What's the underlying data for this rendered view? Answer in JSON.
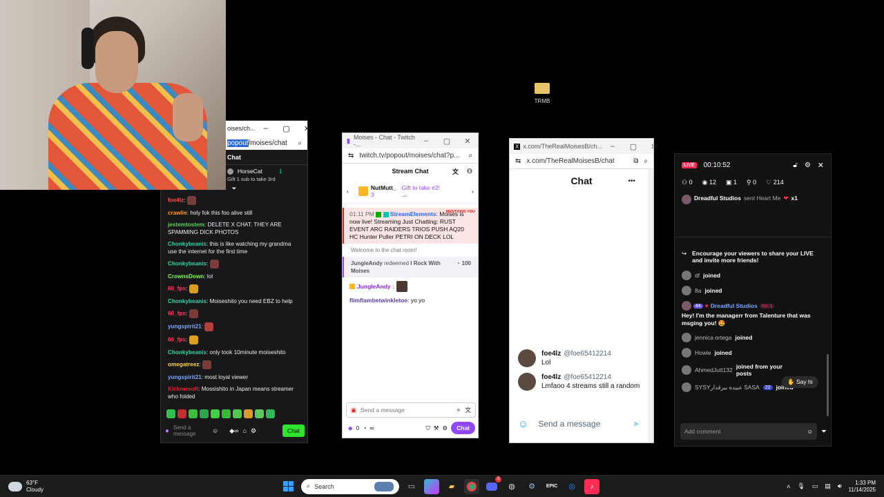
{
  "twitch_left": {
    "url_highlight": "popout",
    "url_rest": "/moises/chat",
    "tab_title": "oises/ch...",
    "header": "Chat",
    "hype_user": "HorseCat",
    "hype_count": "1",
    "hype_text": "Gift 1 sub to take 3rd",
    "messages": [
      {
        "user": "foe4lz",
        "color": "#ff4d4d",
        "text": ""
      },
      {
        "user": "crawlie",
        "color": "#ff9933",
        "text": "holy fok this foo alive still"
      },
      {
        "user": "jestemtostem",
        "color": "#58d058",
        "text": "DELETE X CHAT. THEY ARE SPAMMING DICK PHOTOS"
      },
      {
        "user": "Chonkybeanis",
        "color": "#2fd6a0",
        "text": "this is like watching my grandma use the internet for the first time"
      },
      {
        "user": "Chonkybeanis",
        "color": "#2fd6a0",
        "text": ""
      },
      {
        "user": "CrownsDown",
        "color": "#7cff4a",
        "text": "lol"
      },
      {
        "user": "60_fps",
        "color": "#ff3b5c",
        "text": ""
      },
      {
        "user": "Chonkybeanis",
        "color": "#2fd6a0",
        "text": "Moiseshito you need EBZ to help"
      },
      {
        "user": "60_fps",
        "color": "#ff3b5c",
        "text": ""
      },
      {
        "user": "yungspirit21",
        "color": "#7aa6ff",
        "text": ""
      },
      {
        "user": "60_fps",
        "color": "#ff3b5c",
        "text": ""
      },
      {
        "user": "Chonkybeanis",
        "color": "#2fd6a0",
        "text": "only took 10minute moiseshito"
      },
      {
        "user": "omegatreez",
        "color": "#ffd24d",
        "text": ""
      },
      {
        "user": "yungspirit21",
        "color": "#7aa6ff",
        "text": "most loyal viewer"
      },
      {
        "user": "Klckmesoft",
        "color": "#e0202d",
        "text": "Mossishito in Japan means streamer who folded"
      }
    ],
    "input_placeholder": "Send a message",
    "chat_button": "Chat"
  },
  "twitch_mid": {
    "title": "Moises - Chat - Twitch -...",
    "url": "twitch.tv/popout/moises/chat?p...",
    "header": "Stream Chat",
    "gift_user": "NutMutt_",
    "gift_count": "3",
    "gift_text": "Gift to take #2!",
    "gift_more": "...",
    "mention_tag": "MENTIONS YOU",
    "bot_time": "01:11 PM",
    "bot_user": "StreamElements",
    "bot_text": "Moises is now live! Streaming Just Chatting: RUST EVENT ARC RAIDERS TRIOS PUSH AQ20 HC Hunter Puller PETRI ON DECK LOL",
    "welcome": "Welcome to the chat room!",
    "redeem_user": "JungleAndy",
    "redeem_text": "redeemed",
    "redeem_reward": "I Rock With Moises",
    "redeem_cost": "100",
    "msg1_user": "JungleAndy",
    "msg2_user": "flimflambetwinkletoe",
    "msg2_text": "yo yo",
    "input_placeholder": "Send a message",
    "points": "0",
    "infinity": "∞",
    "chat_button": "Chat"
  },
  "x_chat": {
    "title": "x.com/TheRealMoisesB/ch...",
    "url": "x.com/TheRealMoisesB/chat",
    "header": "Chat",
    "more": "•••",
    "messages": [
      {
        "name": "foe4lz",
        "handle": "@foe65412214",
        "text": "Lol"
      },
      {
        "name": "foe4lz",
        "handle": "@foe65412214",
        "text": "Lmfaoo 4 streams still a random"
      }
    ],
    "input_placeholder": "Send a message"
  },
  "tiktok": {
    "live_badge": "LIVE",
    "timer": "00:10:52",
    "stats": [
      "0",
      "12",
      "1",
      "0",
      "214"
    ],
    "gift_user": "Dreadful Studios",
    "gift_text": "sent Heart Me",
    "gift_mult": "x1",
    "share_prompt": "Encourage your viewers to share your LIVE and invite more friends!",
    "events": [
      {
        "user": "df",
        "action": "joined"
      },
      {
        "user": "8a",
        "action": "joined"
      }
    ],
    "chat_badge_level": "44",
    "chat_rank": "No. 1",
    "chat_user": "Dreadful Studios",
    "chat_text": "Hey! I'm the managerr from Talenture that was msging you! 🤩",
    "events2": [
      {
        "user": "jennica ortega",
        "action": "joined"
      },
      {
        "user": "Howie",
        "action": "joined"
      },
      {
        "user": "AhmedJutt132",
        "action": "joined from your posts"
      },
      {
        "user": "SYSYعبيدة بيرقدار SASA",
        "badge": "22",
        "action": "joined"
      }
    ],
    "say_hi": "Say hi",
    "comment_placeholder": "Add comment"
  },
  "desktop_icon": {
    "label": "TRMB"
  },
  "taskbar": {
    "weather_temp": "63°F",
    "weather_desc": "Cloudy",
    "search_placeholder": "Search",
    "notif_count": "3",
    "time": "1:33 PM",
    "date": "11/14/2025"
  },
  "colors": {
    "twitch_purple": "#9147ff",
    "twitch_green": "#00db84",
    "tiktok_pink": "#fe2c55",
    "x_blue": "#1d9bf0"
  }
}
